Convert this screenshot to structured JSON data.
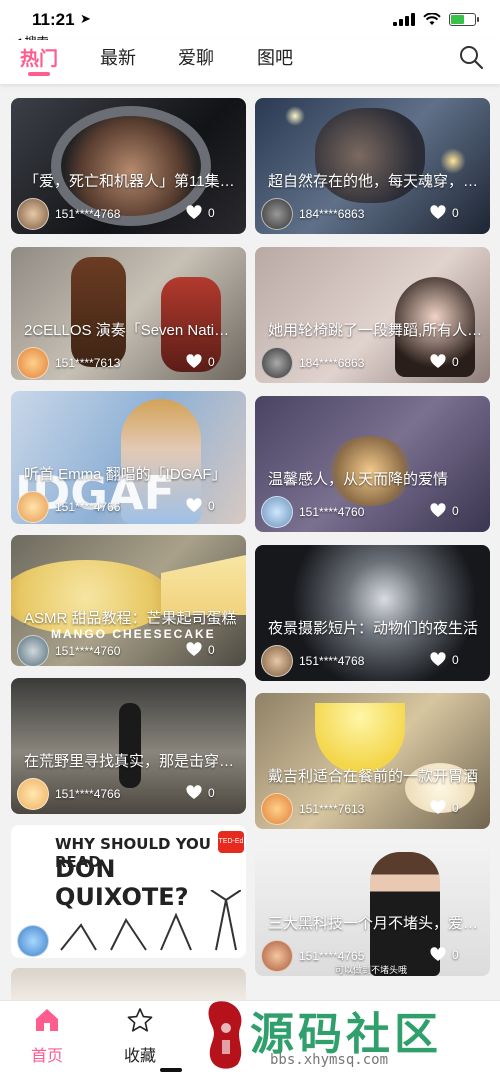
{
  "status": {
    "time": "11:21",
    "back_label": "◀ 搜索"
  },
  "tabs": [
    {
      "label": "热门"
    },
    {
      "label": "最新"
    },
    {
      "label": "爱聊"
    },
    {
      "label": "图吧"
    }
  ],
  "feed": [
    {
      "title": "「爱，死亡和机器人」第11集…",
      "user": "151****4768",
      "likes": "0"
    },
    {
      "title": "超自然存在的他，每天魂穿，…",
      "user": "184****6863",
      "likes": "0"
    },
    {
      "title": "2CELLOS 演奏「Seven Nati…",
      "user": "151****7613",
      "likes": "0"
    },
    {
      "title": "她用轮椅跳了一段舞蹈,所有人…",
      "user": "184****6863",
      "likes": "0"
    },
    {
      "title": "听首 Emma 翻唱的「IDGAF」",
      "user": "151****4766",
      "likes": "0"
    },
    {
      "title": "温馨感人，从天而降的爱情",
      "user": "151****4760",
      "likes": "0"
    },
    {
      "title": "ASMR 甜品教程：芒果起司蛋糕",
      "user": "151****4760",
      "likes": "0"
    },
    {
      "title": "夜景摄影短片：动物们的夜生活",
      "user": "151****4768",
      "likes": "0"
    },
    {
      "title": "在荒野里寻找真实，那是击穿…",
      "user": "151****4766",
      "likes": "0"
    },
    {
      "title": "戴吉利适合在餐前的一款开胃酒",
      "user": "151****7613",
      "likes": "0"
    },
    {
      "title": "",
      "user": "",
      "likes": ""
    },
    {
      "title": "三大黑科技一个月不堵头，爱…",
      "user": "151****4765",
      "likes": "0"
    }
  ],
  "thumb_text": {
    "idgaf": "IDGAF",
    "mango": "MANGO CHEESECAKE",
    "quixote_1": "WHY SHOULD YOU READ",
    "quixote_2": "DON QUIXOTE?",
    "ted": "TED-Ed",
    "subtitle": "可以做到不堵头哦"
  },
  "bottom_nav": [
    {
      "label": "首页",
      "icon": "home-icon"
    },
    {
      "label": "收藏",
      "icon": "star-icon"
    }
  ],
  "watermark": {
    "main": "源码社区",
    "url": "bbs.xhymsq.com",
    "seal": "小猿"
  },
  "colors": {
    "accent": "#ff5d8f",
    "text": "#222222",
    "background": "#f2f2f2"
  }
}
